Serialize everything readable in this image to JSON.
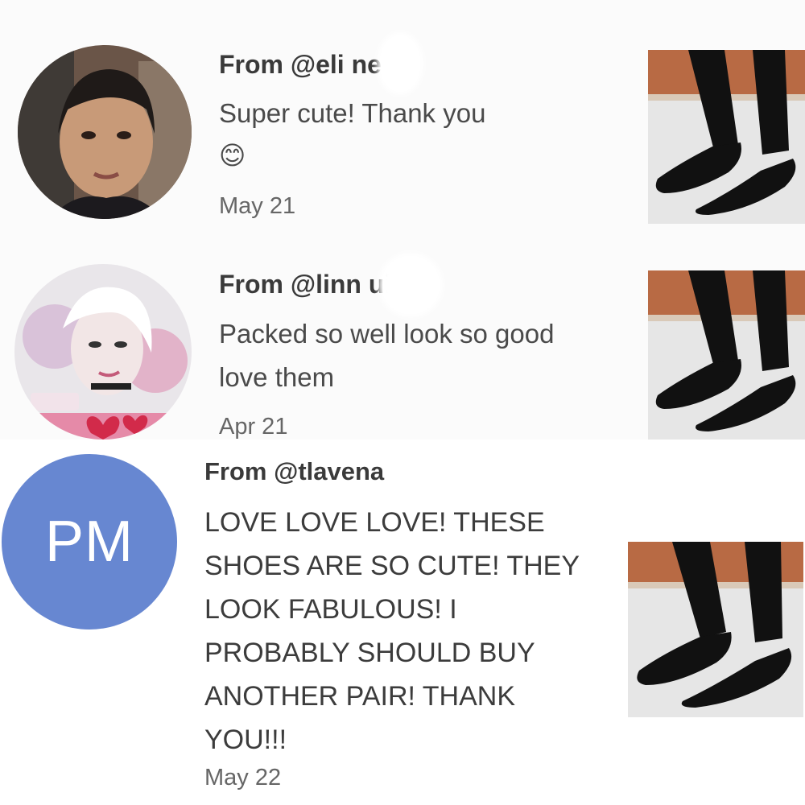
{
  "reviews": [
    {
      "from": "From @eli     ne",
      "body": "Super cute! Thank you",
      "emoji": "😊",
      "date": "May 21"
    },
    {
      "from": "From @linn       uigs",
      "body": "Packed so well look so good love them",
      "date": "Apr 21"
    },
    {
      "from": "From @tlavena",
      "avatar_initials": "PM",
      "body": "LOVE LOVE LOVE! THESE SHOES ARE SO CUTE! THEY LOOK FABULOUS! I PROBABLY SHOULD BUY ANOTHER PAIR!  THANK YOU!!!",
      "date": "May 22"
    }
  ],
  "colors": {
    "monogram_bg": "#6787d1",
    "text_dark": "#3a3a3a",
    "text_date": "#666666"
  },
  "icons": {
    "avatar_1": "user-photo",
    "avatar_2": "user-photo",
    "thumb": "product-photo-black-flats"
  }
}
